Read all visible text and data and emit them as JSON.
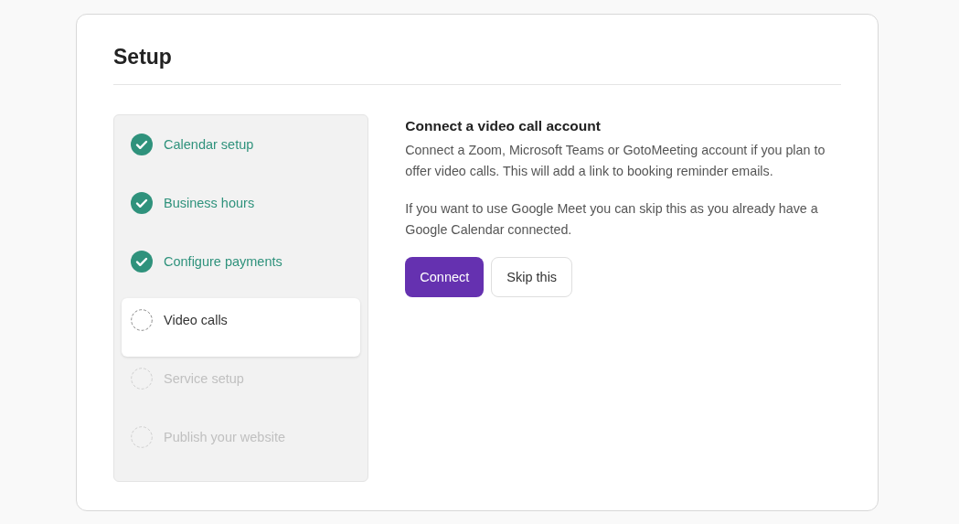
{
  "page": {
    "title": "Setup"
  },
  "steps": [
    {
      "label": "Calendar setup",
      "completed": true,
      "selected": false
    },
    {
      "label": "Business hours",
      "completed": true,
      "selected": false
    },
    {
      "label": "Configure payments",
      "completed": true,
      "selected": false
    },
    {
      "label": "Video calls",
      "completed": false,
      "selected": true
    },
    {
      "label": "Service setup",
      "completed": false,
      "selected": false
    },
    {
      "label": "Publish your website",
      "completed": false,
      "selected": false
    }
  ],
  "content": {
    "heading": "Connect a video call account",
    "paragraphs": [
      "Connect a Zoom, Microsoft Teams or GotoMeeting account if you plan to offer video calls. This will add a link to booking reminder emails.",
      "If you want to use Google Meet you can skip this as you already have a Google Calendar connected."
    ],
    "buttons": [
      {
        "label": "Connect",
        "kind": "primary"
      },
      {
        "label": "Skip this",
        "kind": "secondary"
      }
    ]
  }
}
